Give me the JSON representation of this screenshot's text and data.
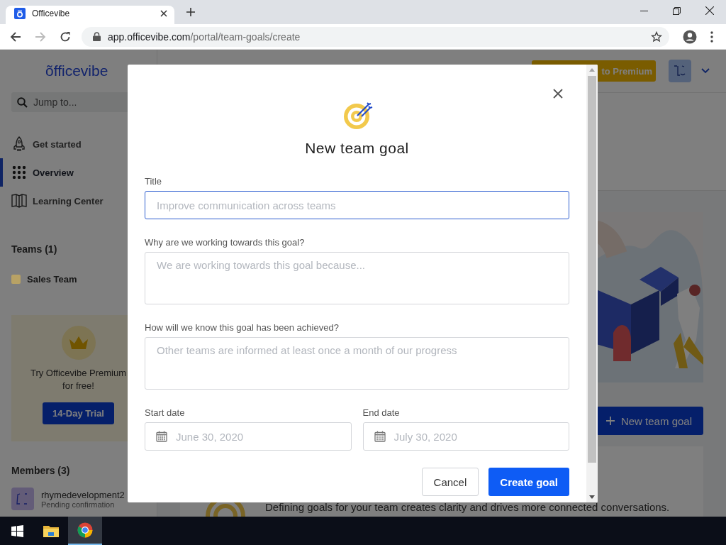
{
  "browser": {
    "tab_title": "Officevibe",
    "url_host": "app.officevibe.com",
    "url_path": "/portal/team-goals/create"
  },
  "header": {
    "logo": "õfficevibe",
    "upgrade_button": "to Premium"
  },
  "sidebar": {
    "search": {
      "placeholder": "Jump to..."
    },
    "nav": [
      {
        "label": "Get started",
        "kind": "rocket",
        "selected": false
      },
      {
        "label": "Overview",
        "kind": "grid",
        "selected": true
      },
      {
        "label": "Learning Center",
        "kind": "book",
        "selected": false
      }
    ],
    "teams_heading": "Teams (1)",
    "teams": [
      {
        "name": "Sales Team",
        "color": "#b8a265"
      }
    ],
    "promo": {
      "text": "Try Officevibe Premium for free!",
      "button": "14-Day Trial"
    },
    "members_heading": "Members (3)",
    "members": [
      {
        "name": "rhymedevelopment2",
        "status": "Pending confirmation"
      }
    ]
  },
  "main": {
    "new_goal_button": "New team goal",
    "description": "Defining goals for your team creates clarity and drives more connected conversations."
  },
  "modal": {
    "title": "New team goal",
    "fields": [
      {
        "kind": "text",
        "label": "Title",
        "placeholder": "Improve communication across teams",
        "focused": true
      },
      {
        "kind": "textarea",
        "label": "Why are we working towards this goal?",
        "placeholder": "We are working towards this goal because...",
        "focused": false
      },
      {
        "kind": "textarea",
        "label": "How will we know this goal has been achieved?",
        "placeholder": "Other teams are informed at least once a month of our progress",
        "focused": false
      }
    ],
    "dates": [
      {
        "label": "Start date",
        "placeholder": "June 30, 2020"
      },
      {
        "label": "End date",
        "placeholder": "July 30, 2020"
      }
    ],
    "cancel_button": "Cancel",
    "create_button": "Create goal"
  },
  "taskbar": [
    {
      "kind": "start",
      "selected": false
    },
    {
      "kind": "explorer",
      "selected": false
    },
    {
      "kind": "chrome",
      "selected": true
    }
  ]
}
